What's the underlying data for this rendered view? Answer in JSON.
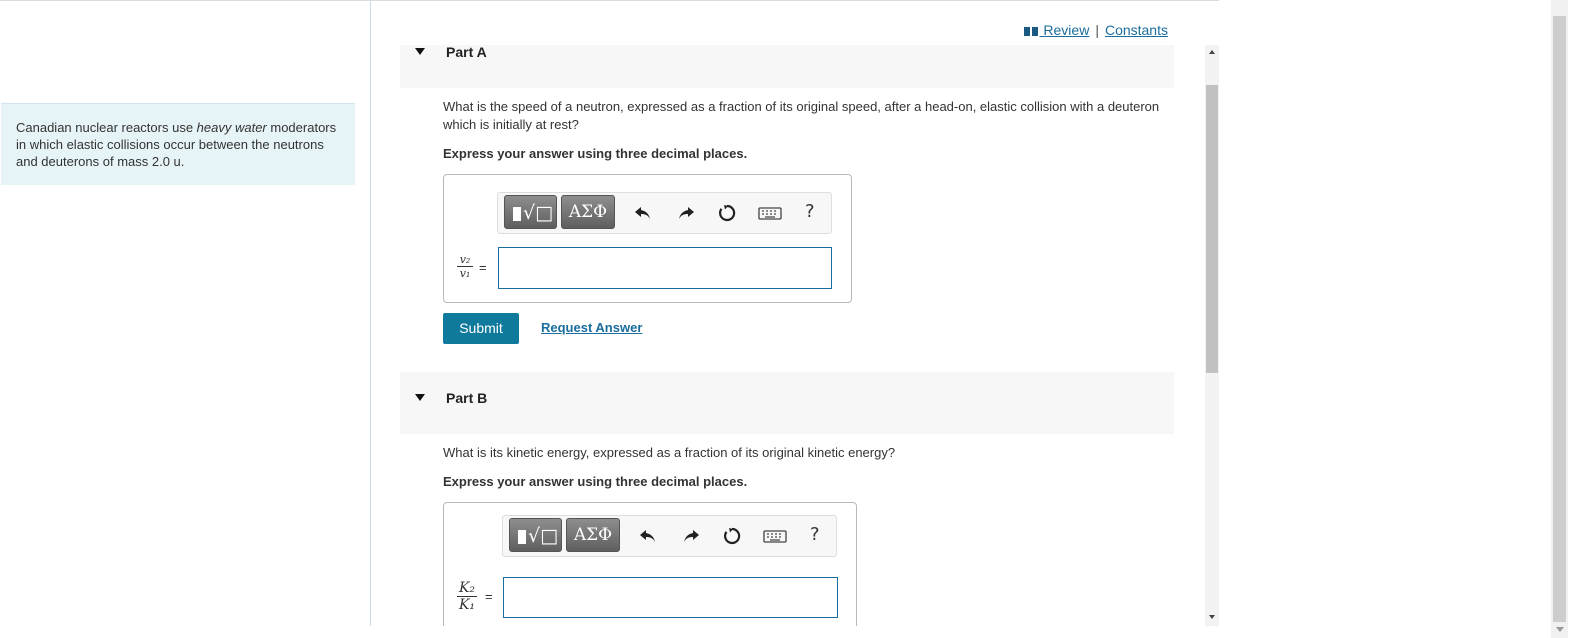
{
  "context": {
    "text_before": "Canadian nuclear reactors use ",
    "text_emphasis": "heavy water",
    "text_after": " moderators in which elastic collisions occur between the neutrons and deuterons of mass 2.0 u."
  },
  "links": {
    "review": " Review",
    "separator": "|",
    "constants": "Constants"
  },
  "parts": [
    {
      "title": "Part A",
      "question": "What is the speed of a neutron, expressed as a fraction of its original speed, after a head-on, elastic collision with a deuteron which is initially at rest?",
      "instruction": "Express your answer using three decimal places.",
      "var_num": "v₂",
      "var_den": "v₁",
      "equals": "=",
      "input_value": "",
      "toolbar": {
        "templates_label": "√□",
        "greek_label": "ΑΣΦ",
        "help": "?"
      },
      "submit": "Submit",
      "request_answer": "Request Answer"
    },
    {
      "title": "Part B",
      "question": "What is its kinetic energy, expressed as a fraction of its original kinetic energy?",
      "instruction": "Express your answer using three decimal places.",
      "var_num": "K₂",
      "var_den": "K₁",
      "equals": "=",
      "input_value": "",
      "toolbar": {
        "templates_label": "√□",
        "greek_label": "ΑΣΦ",
        "help": "?"
      }
    }
  ],
  "colors": {
    "accent": "#0f7a9c",
    "link": "#1a6d9e",
    "context_bg": "#e6f4f7",
    "header_bg": "#f7f7f7"
  },
  "icons": [
    "book-icon",
    "undo-icon",
    "redo-icon",
    "reset-icon",
    "keyboard-icon",
    "help-icon",
    "collapse-triangle-icon"
  ]
}
